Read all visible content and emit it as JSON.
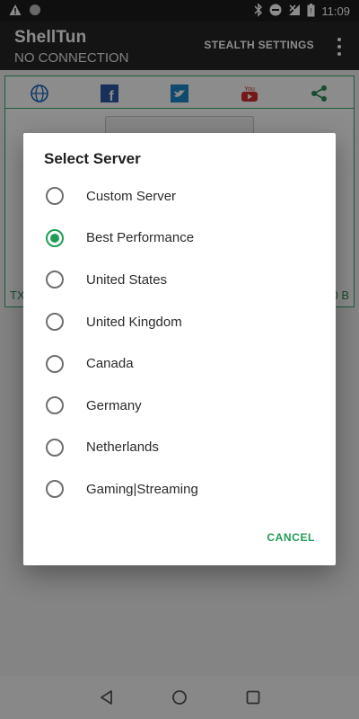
{
  "status_bar": {
    "time": "11:09",
    "left_icons": [
      "warning-icon",
      "circle-icon"
    ],
    "right_icons": [
      "bluetooth-icon",
      "do-not-disturb-icon",
      "no-signal-icon",
      "battery-icon"
    ]
  },
  "app_bar": {
    "title": "ShellTun",
    "subtitle": "NO CONNECTION",
    "action_label": "STEALTH SETTINGS",
    "overflow_icon": "more-vert-icon"
  },
  "background": {
    "share_icons": [
      "globe-icon",
      "facebook-icon",
      "twitter-icon",
      "youtube-icon",
      "share-icon"
    ],
    "tx_label": "TX",
    "rx_label": "0 B",
    "accent": "#38a76a"
  },
  "dialog": {
    "title": "Select Server",
    "options": [
      {
        "label": "Custom Server",
        "selected": false
      },
      {
        "label": "Best Performance",
        "selected": true
      },
      {
        "label": "United States",
        "selected": false
      },
      {
        "label": "United Kingdom",
        "selected": false
      },
      {
        "label": "Canada",
        "selected": false
      },
      {
        "label": "Germany",
        "selected": false
      },
      {
        "label": "Netherlands",
        "selected": false
      },
      {
        "label": "Gaming|Streaming",
        "selected": false
      }
    ],
    "cancel_label": "CANCEL",
    "accent": "#1f9d55"
  },
  "nav_bar": {
    "icons": [
      "back-icon",
      "home-icon",
      "recents-icon"
    ]
  }
}
